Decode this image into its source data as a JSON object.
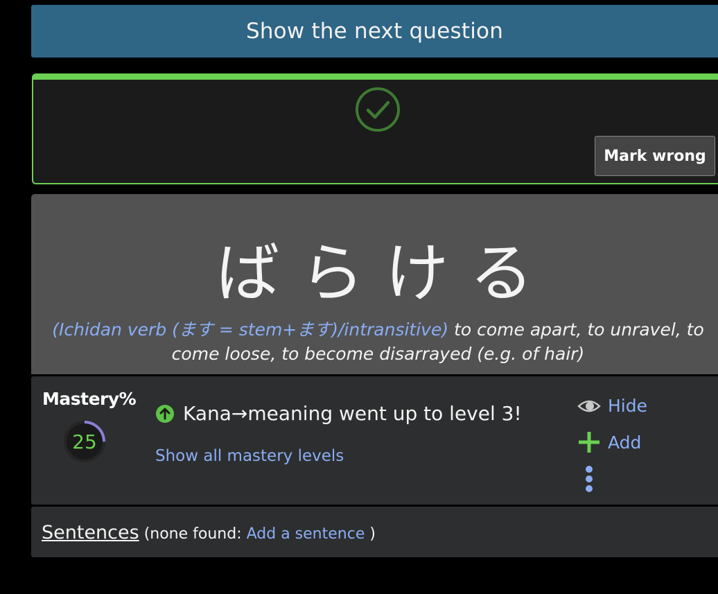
{
  "next_question": {
    "label": "Show the next question"
  },
  "result": {
    "status": "correct",
    "mark_wrong_label": "Mark wrong",
    "accent_color": "#6bd051"
  },
  "word": {
    "kana": "ばらける",
    "part_of_speech": "Ichidan verb (ます = stem+ます)/intransitive",
    "open_paren": "(",
    "close_paren": ")",
    "meaning": " to come apart, to unravel, to come loose, to become disarrayed (e.g. of hair)"
  },
  "mastery": {
    "title": "Mastery%",
    "percent": 25,
    "percent_text": "25",
    "levelup_text": "Kana→meaning went up to level 3!",
    "show_levels_label": "Show all mastery levels",
    "ring_color": "#8a7fd8"
  },
  "actions": {
    "hide_label": "Hide",
    "add_label": "Add"
  },
  "sentences": {
    "title": "Sentences",
    "prefix": " (none found: ",
    "add_label": "Add a sentence",
    "suffix": " )"
  }
}
